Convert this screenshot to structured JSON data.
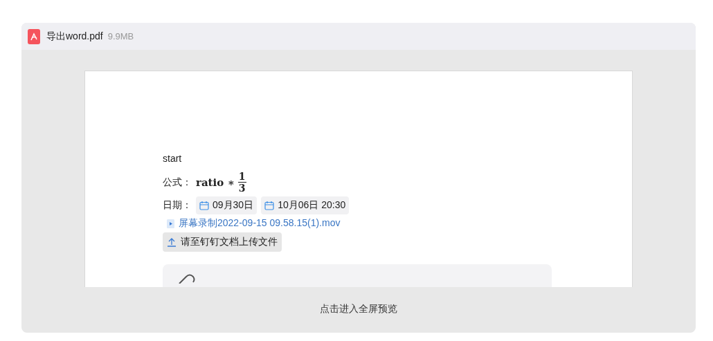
{
  "file": {
    "name": "导出word.pdf",
    "size": "9.9MB"
  },
  "document": {
    "first_line": "start",
    "formula": {
      "label": "公式：",
      "expression": "ratio ∗",
      "numerator": "1",
      "denominator": "3"
    },
    "dates": {
      "label": "日期：",
      "items": [
        "09月30日",
        "10月06日 20:30"
      ]
    },
    "video_link": "屏幕录制2022-09-15 09.58.15(1).mov",
    "upload_button": "请至钉钉文档上传文件"
  },
  "footer": "点击进入全屏预览"
}
